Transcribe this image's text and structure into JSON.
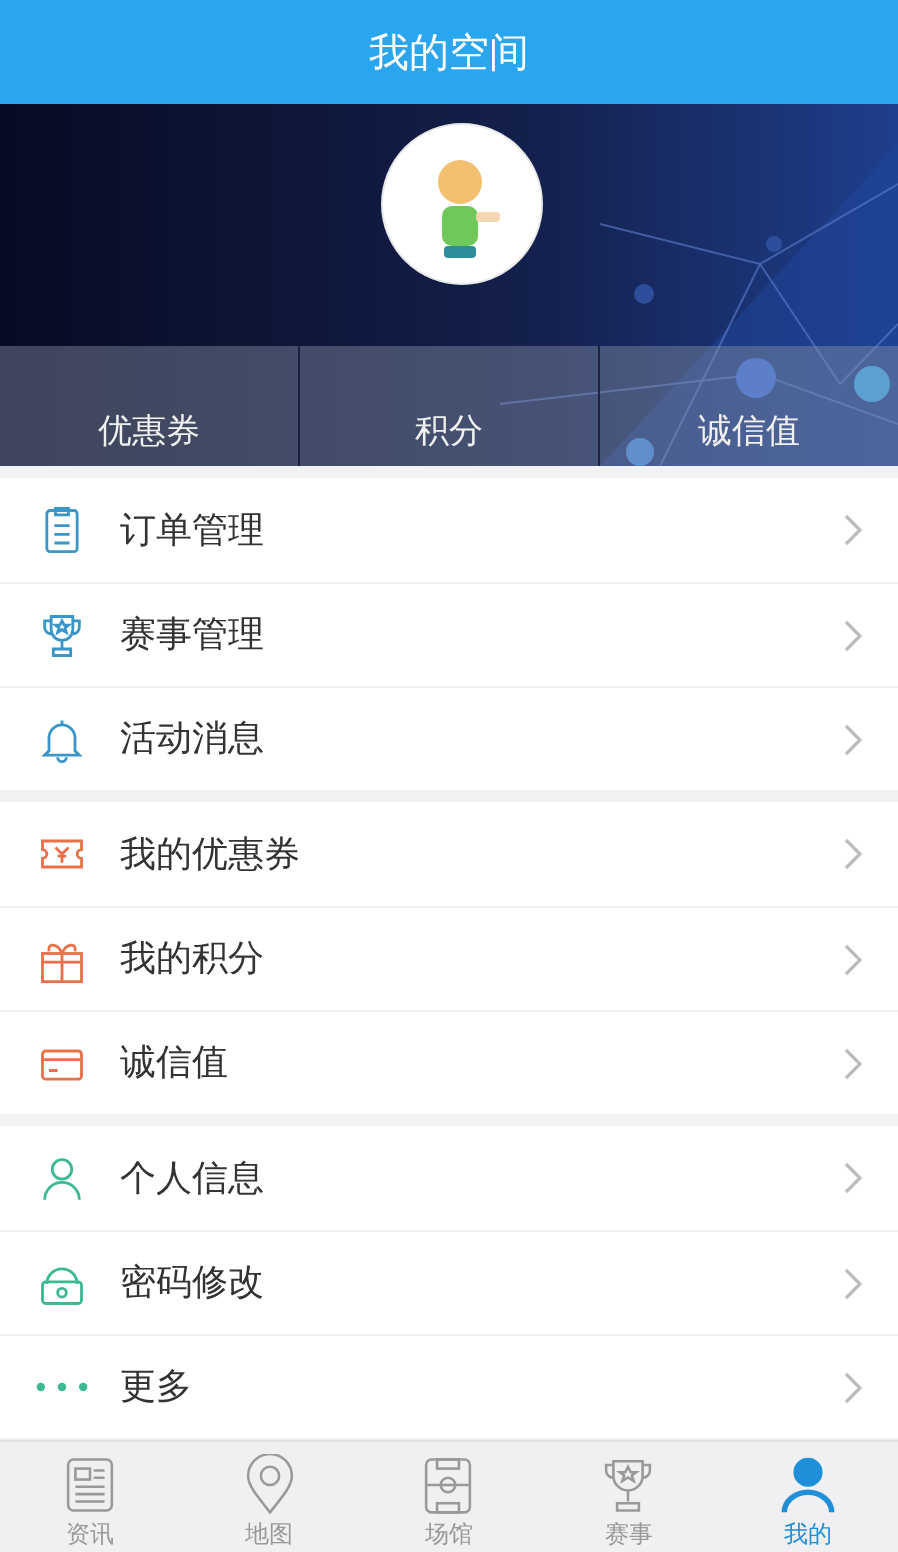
{
  "header": {
    "title": "我的空间"
  },
  "stats": [
    {
      "label": "优惠券"
    },
    {
      "label": "积分"
    },
    {
      "label": "诚信值"
    }
  ],
  "menu_groups": [
    {
      "items": [
        {
          "label": "订单管理"
        },
        {
          "label": "赛事管理"
        },
        {
          "label": "活动消息"
        }
      ]
    },
    {
      "items": [
        {
          "label": "我的优惠券"
        },
        {
          "label": "我的积分"
        },
        {
          "label": "诚信值"
        }
      ]
    },
    {
      "items": [
        {
          "label": "个人信息"
        },
        {
          "label": "密码修改"
        },
        {
          "label": "更多"
        }
      ]
    }
  ],
  "tab_bar": [
    {
      "label": "资讯",
      "selected": false
    },
    {
      "label": "地图",
      "selected": false
    },
    {
      "label": "场馆",
      "selected": false
    },
    {
      "label": "赛事",
      "selected": false
    },
    {
      "label": "我的",
      "selected": true
    }
  ]
}
